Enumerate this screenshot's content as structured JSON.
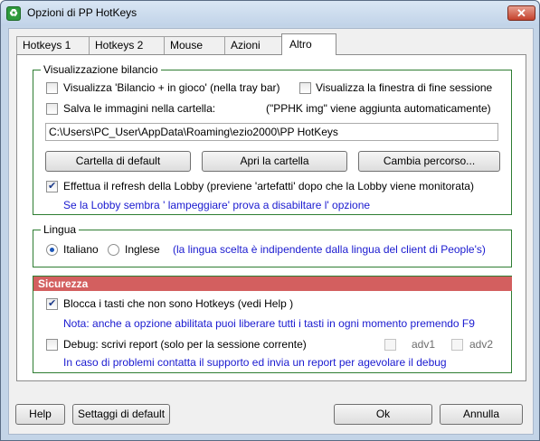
{
  "window": {
    "title": "Opzioni di PP HotKeys",
    "close_label": "✕"
  },
  "tabs": [
    {
      "label": "Hotkeys 1"
    },
    {
      "label": "Hotkeys 2"
    },
    {
      "label": "Mouse"
    },
    {
      "label": "Azioni"
    },
    {
      "label": "Altro",
      "active": true
    }
  ],
  "balance": {
    "legend": "Visualizzazione bilancio",
    "show_balance_label": "Visualizza  'Bilancio + in gioco'  (nella tray bar)",
    "show_balance_checked": false,
    "show_end_session_label": "Visualizza la finestra di fine sessione",
    "show_end_session_checked": false,
    "save_images_label": "Salva le immagini nella cartella:",
    "save_images_checked": false,
    "save_images_note": "(\"PPHK img\" viene aggiunta automaticamente)",
    "path": "C:\\Users\\PC_User\\AppData\\Roaming\\ezio2000\\PP HotKeys",
    "default_folder_button": "Cartella di default",
    "open_folder_button": "Apri la cartella",
    "change_path_button": "Cambia percorso...",
    "refresh_lobby_label": "Effettua il refresh della Lobby (previene 'artefatti' dopo che la Lobby viene monitorata)",
    "refresh_lobby_checked": true,
    "refresh_lobby_note": "Se la Lobby sembra ' lampeggiare'  prova a disabiltare l' opzione"
  },
  "language": {
    "legend": "Lingua",
    "italian_label": "Italiano",
    "english_label": "Inglese",
    "selected": "Italiano",
    "note": "(la lingua scelta è indipendente dalla lingua del client di People's)"
  },
  "security": {
    "header": "Sicurezza",
    "block_keys_label": "Blocca i tasti che non sono Hotkeys   (vedi Help )",
    "block_keys_checked": true,
    "block_keys_note": "Nota: anche a opzione abilitata puoi liberare tutti i tasti in ogni momento premendo F9",
    "debug_label": "Debug: scrivi report  (solo per la sessione corrente)",
    "debug_checked": false,
    "adv1_label": "adv1",
    "adv2_label": "adv2",
    "debug_note": "In caso di problemi contatta il supporto ed invia un report per agevolare il debug"
  },
  "footer": {
    "help_button": "Help",
    "default_settings_button": "Settaggi di default",
    "ok_button": "Ok",
    "cancel_button": "Annulla"
  },
  "colors": {
    "group_border": "#2e7d32",
    "security_header": "#d35f5f",
    "note_text": "#1a1ad0"
  }
}
